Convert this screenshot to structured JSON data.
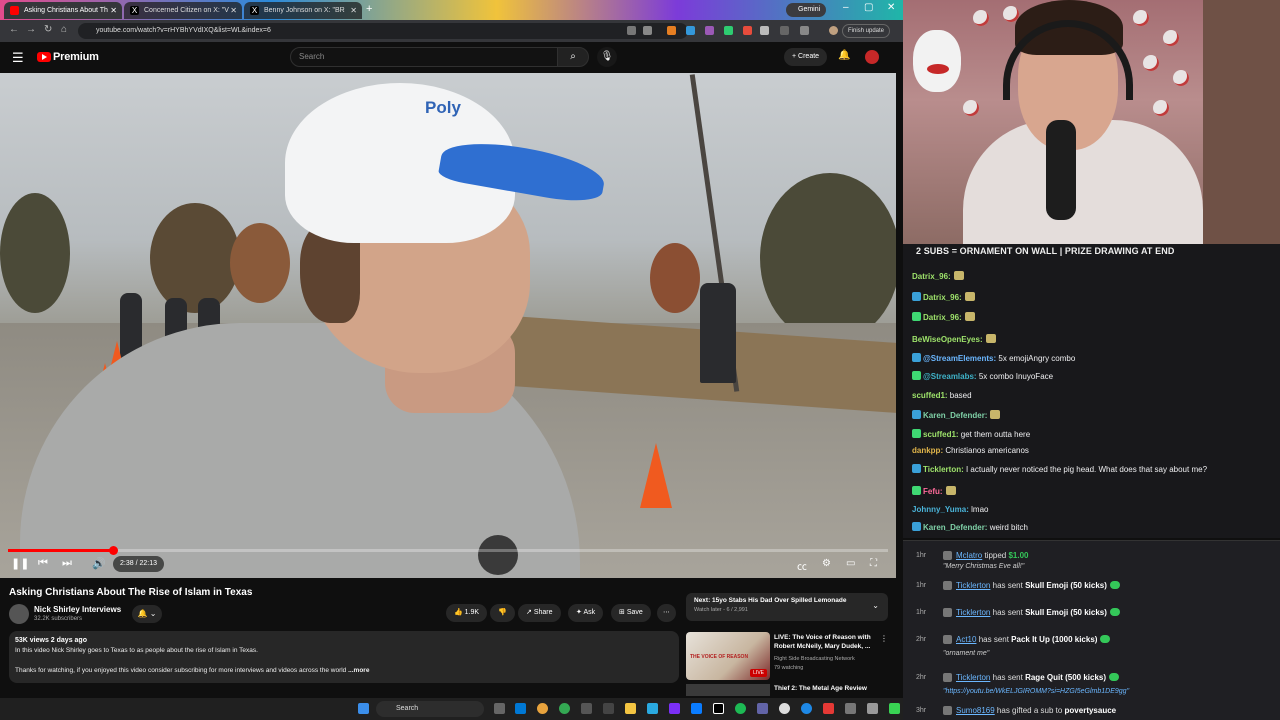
{
  "browser": {
    "tabs": [
      {
        "label": "Asking Christians About Th",
        "active": true
      },
      {
        "label": "Concerned Citizen on X: \"V",
        "active": false
      },
      {
        "label": "Benny Johnson on X: \"BR",
        "active": false
      }
    ],
    "gemini_label": "Gemini",
    "url": "youtube.com/watch?v=rHYBhYVdIXQ&list=WL&index=6",
    "finish_update": "Finish update"
  },
  "youtube": {
    "brand": "Premium",
    "search_placeholder": "Search",
    "create_label": "Create",
    "video": {
      "time": "2:38 / 22:13",
      "progress_fraction": 0.119,
      "cap_logo": "Poly"
    },
    "title": "Asking Christians About The Rise of Islam in Texas",
    "channel": {
      "name": "Nick Shirley Interviews",
      "subscribers": "32.2K subscribers"
    },
    "actions": {
      "likes": "1.9K",
      "share": "Share",
      "ask": "Ask",
      "save": "Save"
    },
    "description": {
      "meta": "53K views  2 days ago",
      "line1": "In this video Nick Shirley goes to Texas to as people about the rise of Islam in Texas.",
      "line2": "Thanks for watching, if you enjoyed this video consider subscribing for more interviews and videos across the world",
      "more": "...more"
    },
    "up_next": {
      "title": "Next: 15yo Stabs His Dad Over Spilled Lemonade",
      "sub": "Watch later - 6 / 2,991"
    },
    "recs": [
      {
        "title": "LIVE: The Voice of Reason with Robert McNeily, Mary Dudek, ...",
        "channel": "Right Side Broadcasting Network",
        "watching": "79 watching",
        "thumb_label": "THE VOICE OF REASON",
        "badge": "LIVE"
      },
      {
        "title": "Thief 2: The Metal Age Review"
      }
    ]
  },
  "taskbar": {
    "search": "Search"
  },
  "stream": {
    "banner": "2 SUBS = ORNAMENT ON WALL | PRIZE DRAWING AT END",
    "chat": [
      {
        "user": "Datrix_96:",
        "text": "",
        "color": "#9ee36b",
        "emote": true
      },
      {
        "user": "Datrix_96:",
        "text": "",
        "color": "#9ee36b",
        "emote": true
      },
      {
        "user": "Datrix_96:",
        "text": "",
        "color": "#9ee36b",
        "emote": true
      },
      {
        "user": "BeWiseOpenEyes:",
        "text": "",
        "color": "#9ee36b",
        "emote": true
      },
      {
        "user": "@StreamElements:",
        "text": "5x emojiAngry combo",
        "color": "#6bb7ff",
        "emote": false
      },
      {
        "user": "@Streamlabs:",
        "text": "5x      combo InuyoFace",
        "color": "#3fb3c9",
        "emote": false
      },
      {
        "user": "scuffed1:",
        "text": "based",
        "color": "#9ee36b",
        "emote": false
      },
      {
        "user": "Karen_Defender:",
        "text": "",
        "color": "#7fd0a7",
        "emote": true
      },
      {
        "user": "scuffed1:",
        "text": "get them outta here",
        "color": "#9ee36b",
        "emote": false
      },
      {
        "user": "dankpp:",
        "text": "Christianos americanos",
        "color": "#e0b44a",
        "emote": false
      },
      {
        "user": "Ticklerton:",
        "text": "I actually never noticed the pig head. What does that say about me?",
        "color": "#9ee36b",
        "emote": false
      },
      {
        "user": "Fefu:",
        "text": "",
        "color": "#ff6b9a",
        "emote": true
      },
      {
        "user": "Johnny_Yuma:",
        "text": "lmao",
        "color": "#4ab3d8",
        "emote": false
      },
      {
        "user": "Karen_Defender:",
        "text": "weird bitch",
        "color": "#7fd0a7",
        "emote": false
      }
    ],
    "events": [
      {
        "time": "1hr",
        "user": "Mclatro",
        "action": "tipped",
        "amount": "$1.00",
        "note": "\"Merry Christmas Eve all!\""
      },
      {
        "time": "1hr",
        "user": "Ticklerton",
        "action": "has sent",
        "amount": "Skull Emoji (50 kicks)"
      },
      {
        "time": "1hr",
        "user": "Ticklerton",
        "action": "has sent",
        "amount": "Skull Emoji (50 kicks)"
      },
      {
        "time": "2hr",
        "user": "Act10",
        "action": "has sent",
        "amount": "Pack It Up (1000 kicks)",
        "note": "\"ornament me\""
      },
      {
        "time": "2hr",
        "user": "Ticklerton",
        "action": "has sent",
        "amount": "Rage Quit (500 kicks)",
        "note": "\"https://youtu.be/WkELJGIROMM?si=HZGI5eGlmb1DE9gg\""
      },
      {
        "time": "3hr",
        "user": "Sumo8169",
        "action": "has gifted a sub to",
        "amount": "povertysauce"
      }
    ]
  }
}
